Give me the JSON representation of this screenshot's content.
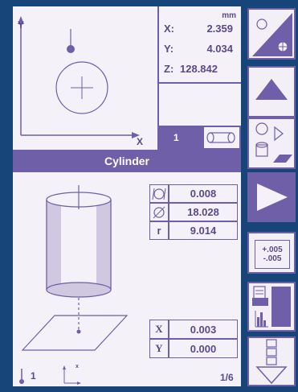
{
  "axes": {
    "y_label": "Y",
    "x_label": "X"
  },
  "coords": {
    "unit": "mm",
    "x_label": "X:",
    "x_value": "2.359",
    "y_label": "Y:",
    "y_value": "4.034",
    "z_label": "Z:",
    "z_value": "128.842"
  },
  "point_count": "1",
  "feature": {
    "title": "Cylinder",
    "rows": [
      {
        "symbol": "cylindricity",
        "value": "0.008"
      },
      {
        "symbol": "diameter",
        "value": "18.028"
      },
      {
        "symbol": "r",
        "value": "9.014"
      }
    ],
    "position_rows": [
      {
        "symbol": "X",
        "value": "0.003"
      },
      {
        "symbol": "Y",
        "value": "0.000"
      }
    ]
  },
  "footer": {
    "datum_count": "1",
    "axis_mini_label": "x",
    "page": "1/6"
  },
  "tolerance_button": {
    "plus": "+.005",
    "minus": "-.005"
  },
  "colors": {
    "background": "#17457a",
    "accent": "#6f5ea8",
    "panel": "#f4f2f8"
  }
}
